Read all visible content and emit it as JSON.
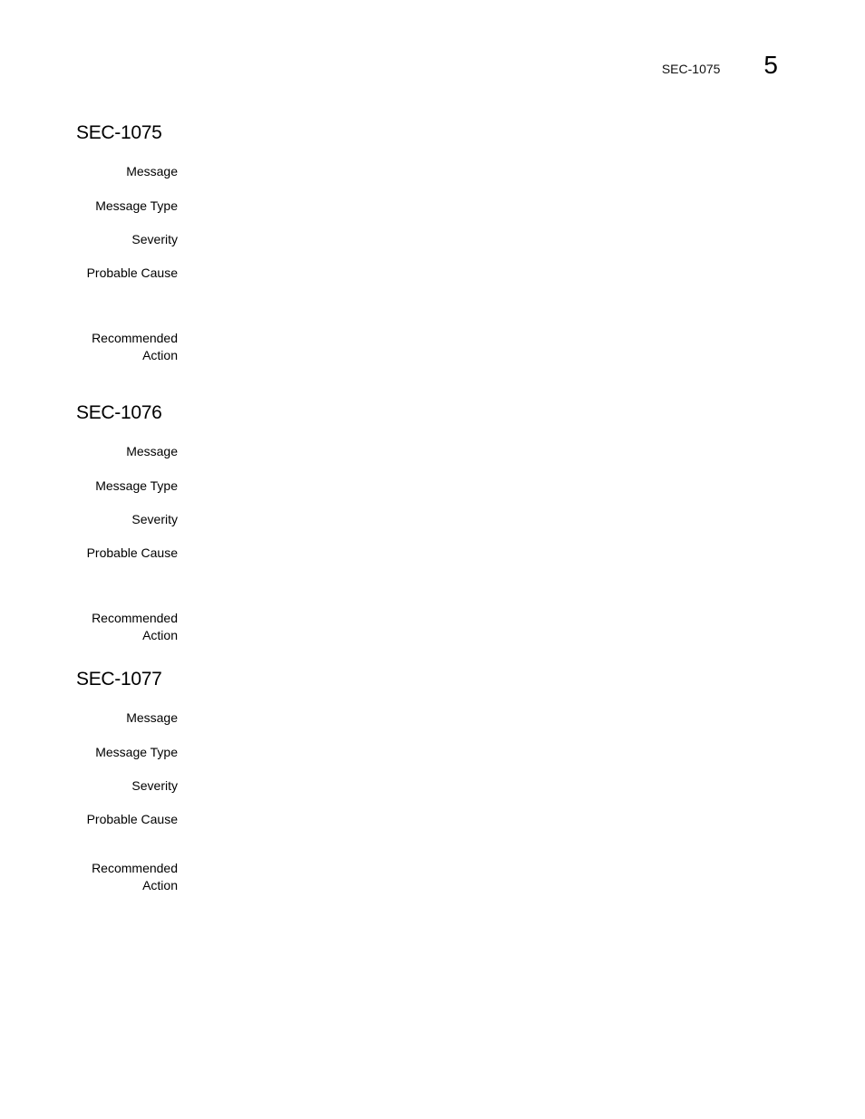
{
  "header": {
    "running_title": "SEC-1075",
    "chapter_number": "5"
  },
  "sections": [
    {
      "title": "SEC-1075",
      "fields": {
        "message": {
          "label": "Message",
          "value": ""
        },
        "message_type": {
          "label": "Message Type",
          "value": ""
        },
        "severity": {
          "label": "Severity",
          "value": ""
        },
        "probable_cause": {
          "label": "Probable Cause",
          "value": ""
        },
        "recommended_action": {
          "label_line1": "Recommended",
          "label_line2": "Action",
          "value": ""
        }
      }
    },
    {
      "title": "SEC-1076",
      "fields": {
        "message": {
          "label": "Message",
          "value": ""
        },
        "message_type": {
          "label": "Message Type",
          "value": ""
        },
        "severity": {
          "label": "Severity",
          "value": ""
        },
        "probable_cause": {
          "label": "Probable Cause",
          "value": ""
        },
        "recommended_action": {
          "label_line1": "Recommended",
          "label_line2": "Action",
          "value": ""
        }
      }
    },
    {
      "title": "SEC-1077",
      "fields": {
        "message": {
          "label": "Message",
          "value": ""
        },
        "message_type": {
          "label": "Message Type",
          "value": ""
        },
        "severity": {
          "label": "Severity",
          "value": ""
        },
        "probable_cause": {
          "label": "Probable Cause",
          "value": ""
        },
        "recommended_action": {
          "label_line1": "Recommended",
          "label_line2": "Action",
          "value": ""
        }
      }
    }
  ]
}
